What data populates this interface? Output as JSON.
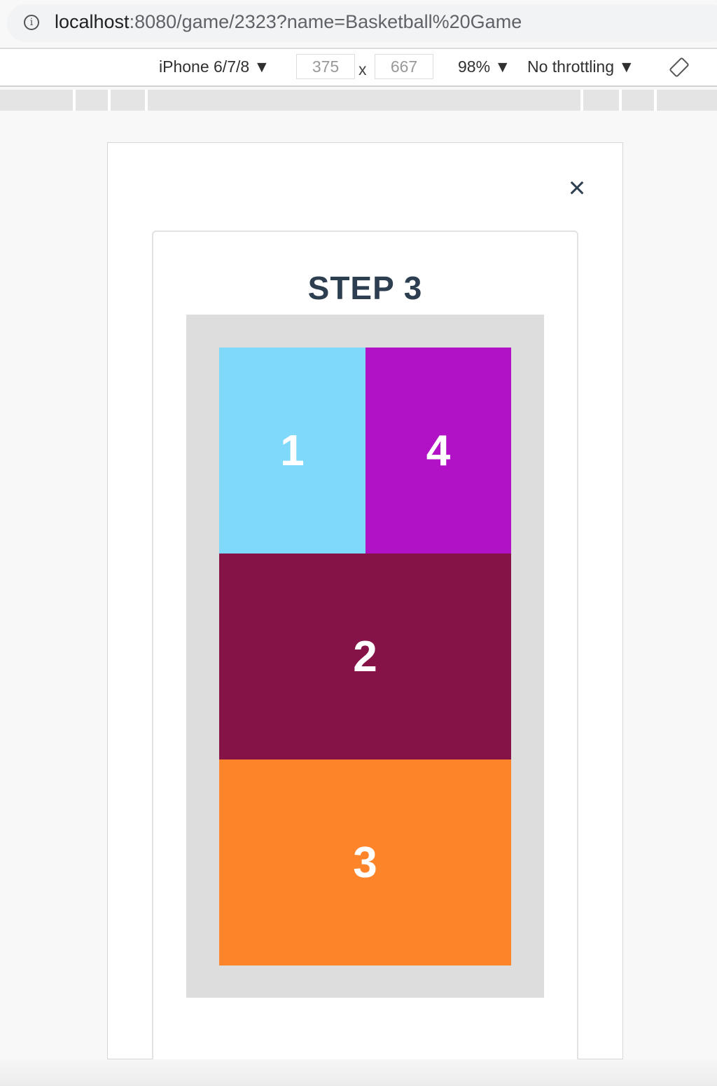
{
  "browser": {
    "url_host": "localhost",
    "url_rest": ":8080/game/2323?name=Basketball%20Game",
    "info_icon": "i"
  },
  "devtools": {
    "device": "iPhone 6/7/8 ▼",
    "width": "375",
    "times": "x",
    "height": "667",
    "zoom": "98% ▼",
    "throttling": "No throttling ▼",
    "rotate_icon": "rotate-icon"
  },
  "game": {
    "close_label": "×",
    "title": "STEP 3",
    "tiles": [
      {
        "label": "1",
        "color": "#7fd9fb"
      },
      {
        "label": "4",
        "color": "#b212c5"
      },
      {
        "label": "2",
        "color": "#861348"
      },
      {
        "label": "3",
        "color": "#fd8429"
      }
    ]
  }
}
